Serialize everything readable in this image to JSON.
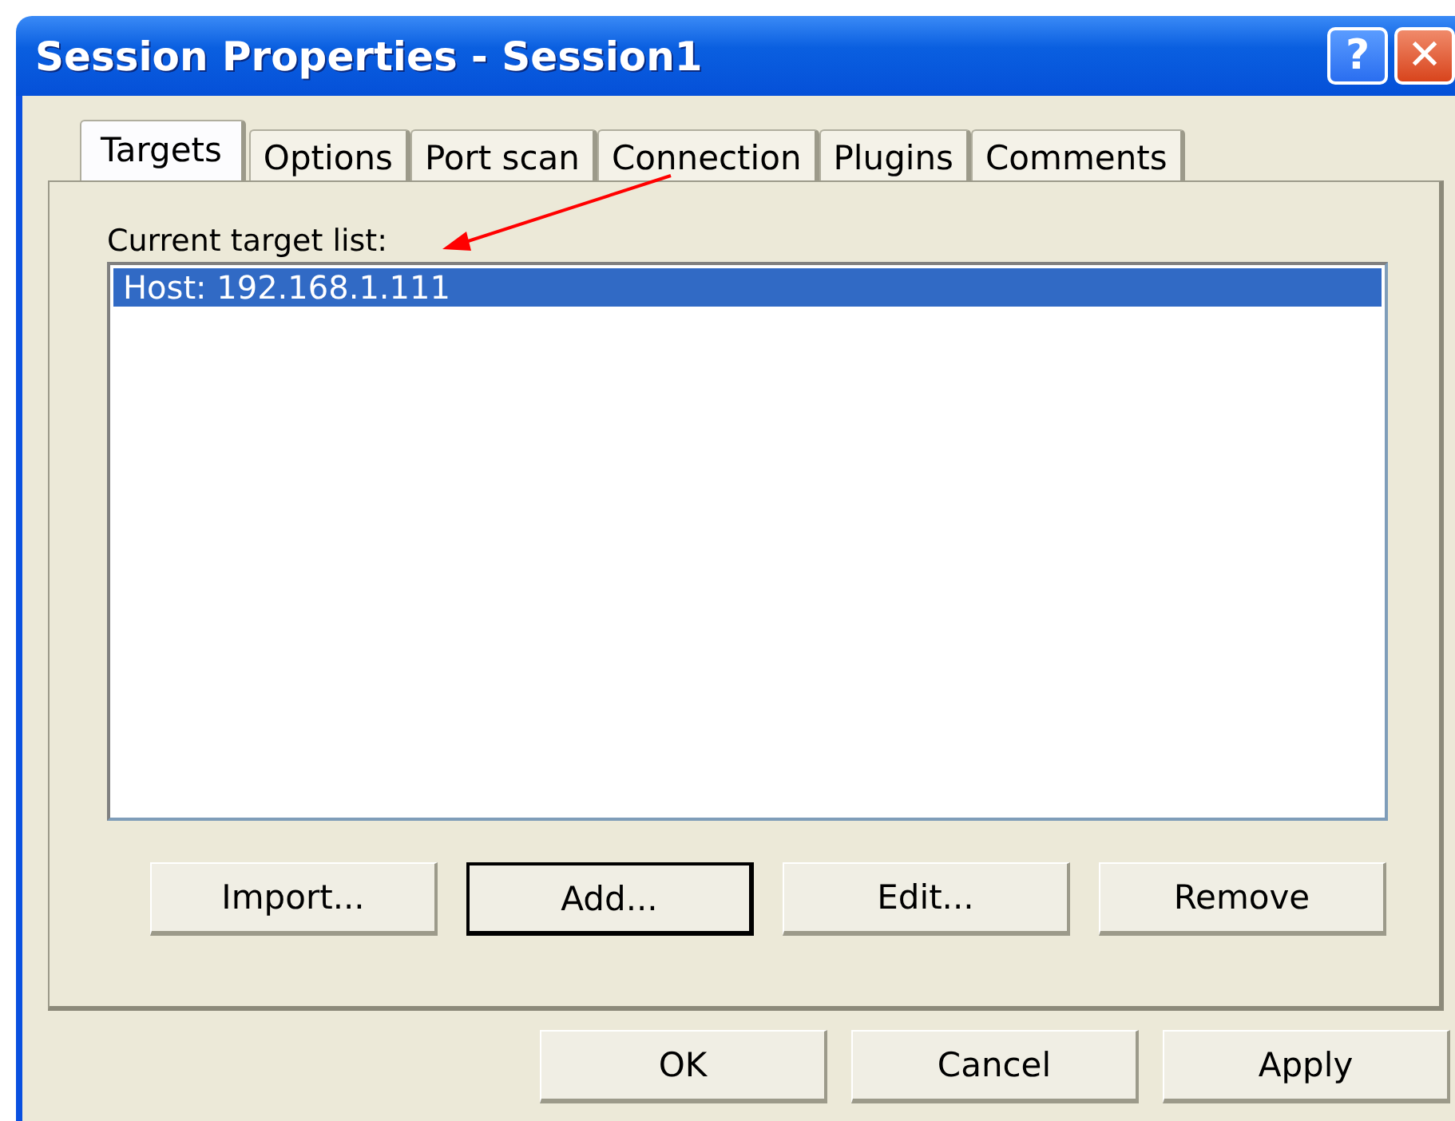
{
  "window": {
    "title": "Session Properties - Session1",
    "help_button": "?",
    "close_button": "✕"
  },
  "tabs": [
    {
      "label": "Targets",
      "selected": true
    },
    {
      "label": "Options",
      "selected": false
    },
    {
      "label": "Port scan",
      "selected": false
    },
    {
      "label": "Connection",
      "selected": false
    },
    {
      "label": "Plugins",
      "selected": false
    },
    {
      "label": "Comments",
      "selected": false
    }
  ],
  "target_list": {
    "label": "Current target list:",
    "items": [
      {
        "text": "Host: 192.168.1.111",
        "selected": true
      }
    ]
  },
  "list_buttons": [
    {
      "label": "Import...",
      "default": false
    },
    {
      "label": "Add...",
      "default": true
    },
    {
      "label": "Edit...",
      "default": false
    },
    {
      "label": "Remove",
      "default": false
    }
  ],
  "dialog_buttons": [
    {
      "label": "OK",
      "default": false
    },
    {
      "label": "Cancel",
      "default": false
    },
    {
      "label": "Apply",
      "default": false
    }
  ]
}
